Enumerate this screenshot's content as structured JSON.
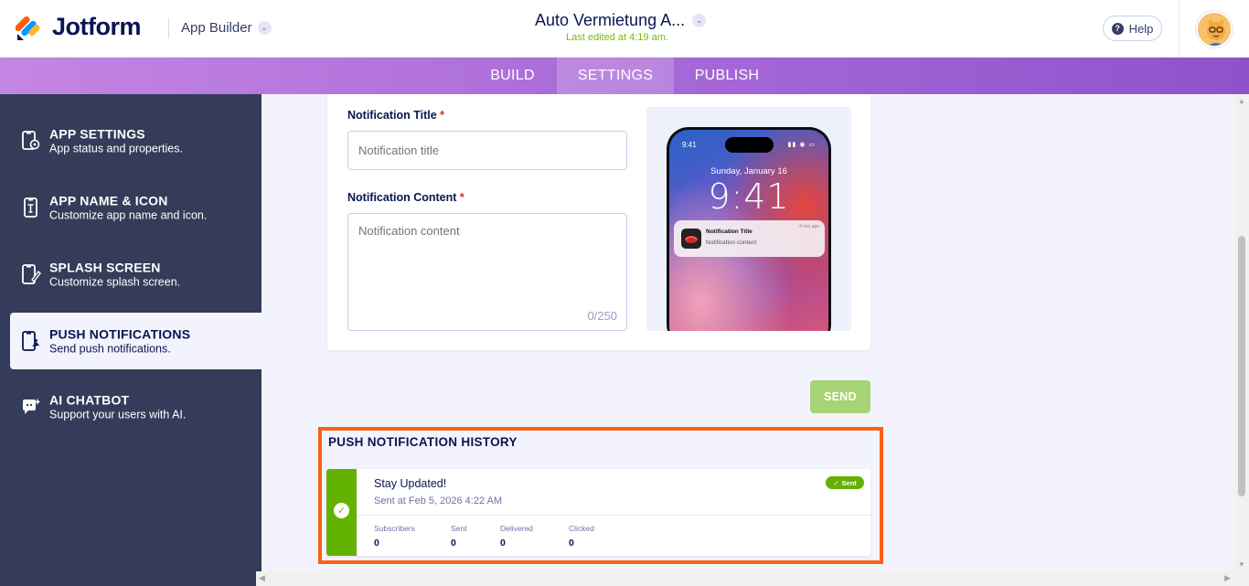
{
  "header": {
    "brand": "Jotform",
    "product_switcher": "App Builder",
    "app_title": "Auto Vermietung A...",
    "last_edited": "Last edited at 4:19 am.",
    "help_label": "Help"
  },
  "tabs": [
    {
      "label": "BUILD",
      "active": false
    },
    {
      "label": "SETTINGS",
      "active": true
    },
    {
      "label": "PUBLISH",
      "active": false
    }
  ],
  "sidebar": {
    "items": [
      {
        "title": "APP SETTINGS",
        "subtitle": "App status and properties.",
        "icon": "app-settings-icon",
        "active": false
      },
      {
        "title": "APP NAME & ICON",
        "subtitle": "Customize app name and icon.",
        "icon": "app-name-icon",
        "active": false
      },
      {
        "title": "SPLASH SCREEN",
        "subtitle": "Customize splash screen.",
        "icon": "splash-screen-icon",
        "active": false
      },
      {
        "title": "PUSH NOTIFICATIONS",
        "subtitle": "Send push notifications.",
        "icon": "push-notification-icon",
        "active": true
      },
      {
        "title": "AI CHATBOT",
        "subtitle": "Support your users with AI.",
        "icon": "ai-chatbot-icon",
        "active": false
      }
    ]
  },
  "form": {
    "title_label": "Notification Title",
    "title_placeholder": "Notification title",
    "content_label": "Notification Content",
    "content_placeholder": "Notification content",
    "required_mark": "*",
    "char_counter": "0/250",
    "send_label": "SEND"
  },
  "preview": {
    "status_time": "9:41",
    "date": "Sunday, January 16",
    "time": "9:41",
    "notification_title": "Notification Title",
    "notification_body": "Notification content",
    "notification_ago": "4 min ago"
  },
  "history": {
    "section_title": "PUSH NOTIFICATION HISTORY",
    "entries": [
      {
        "name": "Stay Updated!",
        "sent_at": "Sent at Feb 5, 2026 4:22 AM",
        "status": "Sent",
        "stats": [
          {
            "label": "Subscribers",
            "value": "0"
          },
          {
            "label": "Sent",
            "value": "0"
          },
          {
            "label": "Delivered",
            "value": "0"
          },
          {
            "label": "Clicked",
            "value": "0"
          }
        ]
      }
    ]
  },
  "colors": {
    "brand_navy": "#0a1551",
    "accent_purple": "#a96ad8",
    "sidebar_bg": "#343c5a",
    "success_green": "#64b200",
    "send_disabled": "#a5d474",
    "highlight_orange": "#fa6215"
  }
}
